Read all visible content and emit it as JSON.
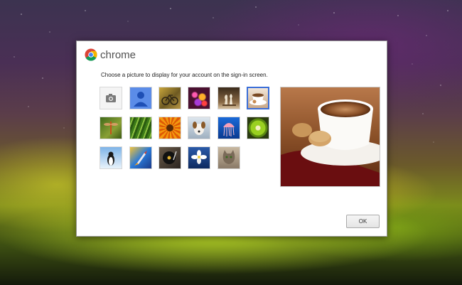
{
  "window": {
    "app_name": "chrome"
  },
  "dialog": {
    "prompt": "Choose a picture to display for your account on the sign-in screen.",
    "ok_label": "OK",
    "selected_picture": "coffee"
  },
  "pictures": [
    {
      "name": "camera",
      "icon": "camera-icon"
    },
    {
      "name": "profile",
      "icon": "person-icon"
    },
    {
      "name": "bicycle"
    },
    {
      "name": "bokeh-lights"
    },
    {
      "name": "chess"
    },
    {
      "name": "coffee"
    },
    {
      "name": "dragonfly"
    },
    {
      "name": "grass"
    },
    {
      "name": "sunflower"
    },
    {
      "name": "dog"
    },
    {
      "name": "jellyfish"
    },
    {
      "name": "kiwi"
    },
    {
      "name": "penguin"
    },
    {
      "name": "rocket"
    },
    {
      "name": "turntable"
    },
    {
      "name": "white-flower"
    },
    {
      "name": "kitten"
    }
  ],
  "colors": {
    "selection": "#3a6ed8",
    "profile_tile": "#5b8ce8"
  }
}
